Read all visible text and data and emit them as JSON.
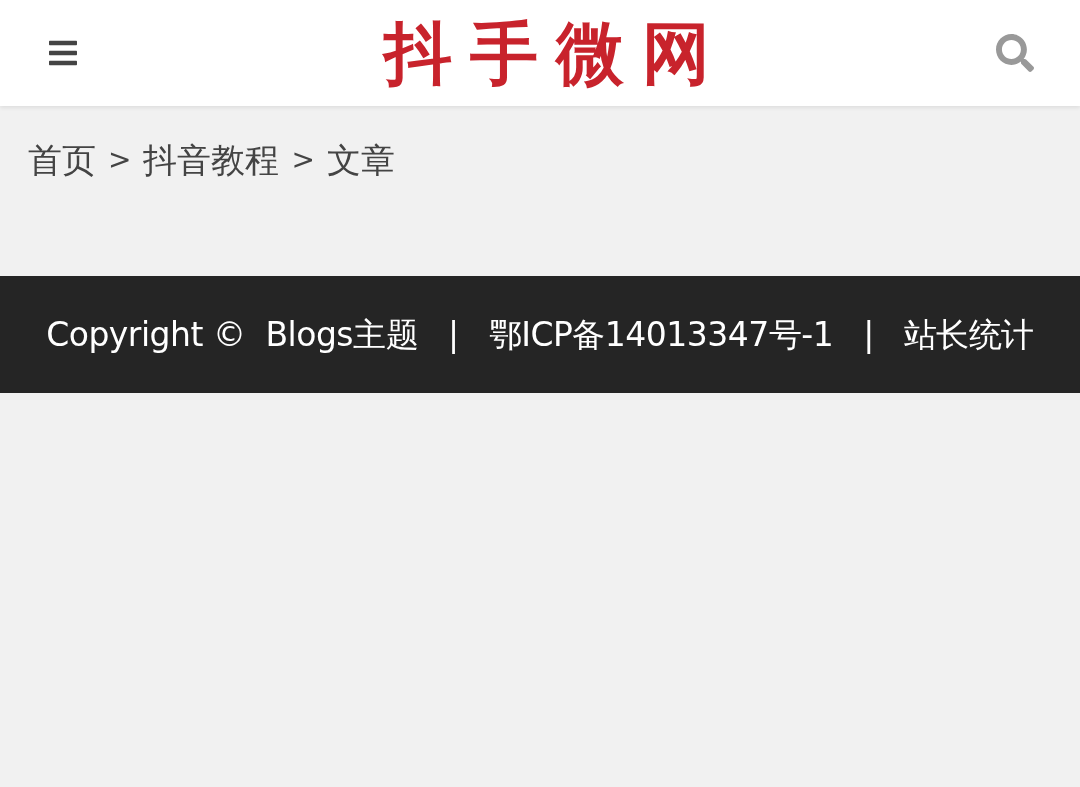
{
  "header": {
    "logo": "抖手微网"
  },
  "breadcrumb": {
    "items": [
      "首页",
      "抖音教程",
      "文章"
    ],
    "separator": ">"
  },
  "footer": {
    "copyright": "Copyright ©",
    "links": [
      "Blogs主题",
      "鄂ICP备14013347号-1",
      "站长统计"
    ],
    "separator": "|"
  }
}
